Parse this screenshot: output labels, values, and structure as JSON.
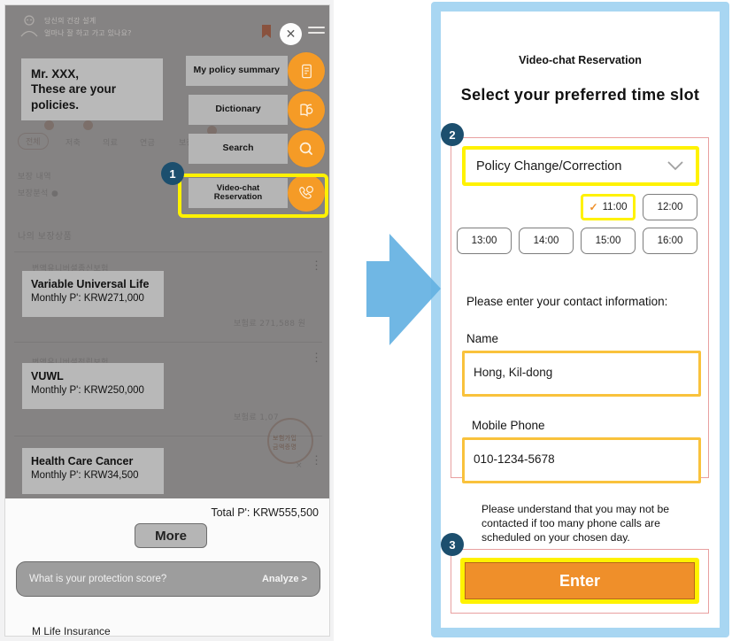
{
  "left_phone": {
    "header": {
      "korean_line1": "당신의 건강 설계",
      "korean_line2": "얼마나 잘 하고 가고 있나요?",
      "close_icon": "close-icon",
      "menu_icon": "hamburger-menu-icon",
      "ribbon_icon": "ribbon-icon"
    },
    "speech_bubble": "Mr. XXX,\nThese are your\npolicies.",
    "menu_items": [
      {
        "label": "My policy  summary",
        "icon": "document-icon"
      },
      {
        "label": "Dictionary",
        "icon": "book-icon"
      },
      {
        "label": "Search",
        "icon": "magnifier-icon"
      },
      {
        "label": "Video-chat\nReservation",
        "icon": "video-call-icon"
      }
    ],
    "policies": [
      {
        "name": "Variable Universal Life",
        "premium": "Monthly P': KRW271,000"
      },
      {
        "name": "VUWL",
        "premium": "Monthly P': KRW250,000"
      },
      {
        "name": "Health Care Cancer",
        "premium": "Monthly P': KRW34,500"
      }
    ],
    "total_label": "Total P': KRW555,500",
    "more_button": "More",
    "protection_bar": {
      "question": "What is your protection  score?",
      "cta": "Analyze  >"
    },
    "brand": "M Life Insurance",
    "ghost_text": {
      "section_label": "나의 보장상품",
      "amount1": "보험료  271,588 원",
      "amount2": "보험료  1,07",
      "tabs": [
        "전체",
        "저축",
        "의료",
        "연금",
        "보장"
      ]
    }
  },
  "right_phone": {
    "title": "Video-chat Reservation",
    "heading": "Select  your preferred  time slot",
    "dropdown": {
      "value": "Policy Change/Correction",
      "chevron_icon": "chevron-down-icon"
    },
    "time_slots": [
      {
        "label": "11:00",
        "selected": true
      },
      {
        "label": "12:00",
        "selected": false
      },
      {
        "label": "13:00",
        "selected": false
      },
      {
        "label": "14:00",
        "selected": false
      },
      {
        "label": "15:00",
        "selected": false
      },
      {
        "label": "16:00",
        "selected": false
      }
    ],
    "contact_prompt": "Please enter your contact information:",
    "name_label": "Name",
    "name_value": "Hong, Kil-dong",
    "phone_label": "Mobile Phone",
    "phone_value": "010-1234-5678",
    "note": "Please understand that you may not be contacted if too many phone calls are scheduled on your chosen day.",
    "enter_button": "Enter"
  },
  "annotations": {
    "badge1": "1",
    "badge2": "2",
    "badge3": "3"
  },
  "colors": {
    "accent_orange": "#ef8f2a",
    "menu_orange": "#f59b26",
    "highlight_yellow": "#fff200",
    "field_yellow": "#f9c23c",
    "badge_navy": "#1c4f6e",
    "phone_border_blue": "#a8d6f2",
    "arrow_blue": "#5aaee0",
    "outline_red": "#e8a0a0",
    "overlay_gray": "#b8b8b8"
  }
}
